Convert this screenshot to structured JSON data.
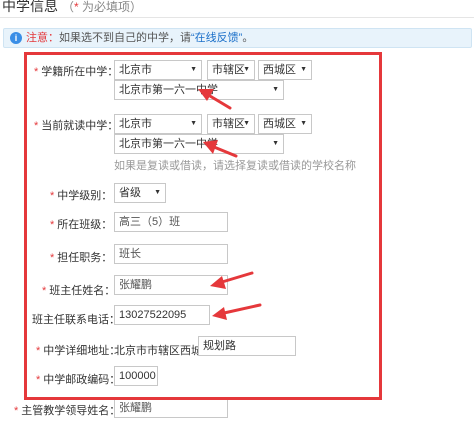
{
  "section": {
    "title": "中学信息",
    "required_note_open": "（",
    "required_note_star": "*",
    "required_note_text": " 为必填项）"
  },
  "notice": {
    "icon": "info-icon",
    "label": "注意：",
    "text": "如果选不到自己的中学，请",
    "link": "“在线反馈”",
    "tail": "。"
  },
  "form": {
    "school_register": {
      "label": "学籍所在中学：",
      "city": "北京市",
      "district": "市辖区",
      "county": "西城区",
      "school": "北京市第一六一中学"
    },
    "current_school": {
      "label": "当前就读中学：",
      "city": "北京市",
      "district": "市辖区",
      "county": "西城区",
      "school": "北京市第一六一中学",
      "hint": "如果是复读或借读，请选择复读或借读的学校名称"
    },
    "school_level": {
      "label": "中学级别：",
      "value": "省级"
    },
    "class": {
      "label": "所在班级：",
      "value": "高三（5）班"
    },
    "position": {
      "label": "担任职务：",
      "value": "班长"
    },
    "head_teacher_name": {
      "label": "班主任姓名：",
      "value": "张耀鹏"
    },
    "head_teacher_phone": {
      "label": "班主任联系电话：",
      "value": "13027522095"
    },
    "address": {
      "label": "中学详细地址：",
      "prefix": "北京市市辖区西城区",
      "value": "规划路"
    },
    "postcode": {
      "label": "中学邮政编码：",
      "value": "100000"
    },
    "teaching_director_name": {
      "label": "主管教学领导姓名：",
      "value": "张耀鹏"
    }
  },
  "colors": {
    "required_star": "#e4393c",
    "annotation": "#e5383b",
    "link": "#1a6fc9"
  }
}
